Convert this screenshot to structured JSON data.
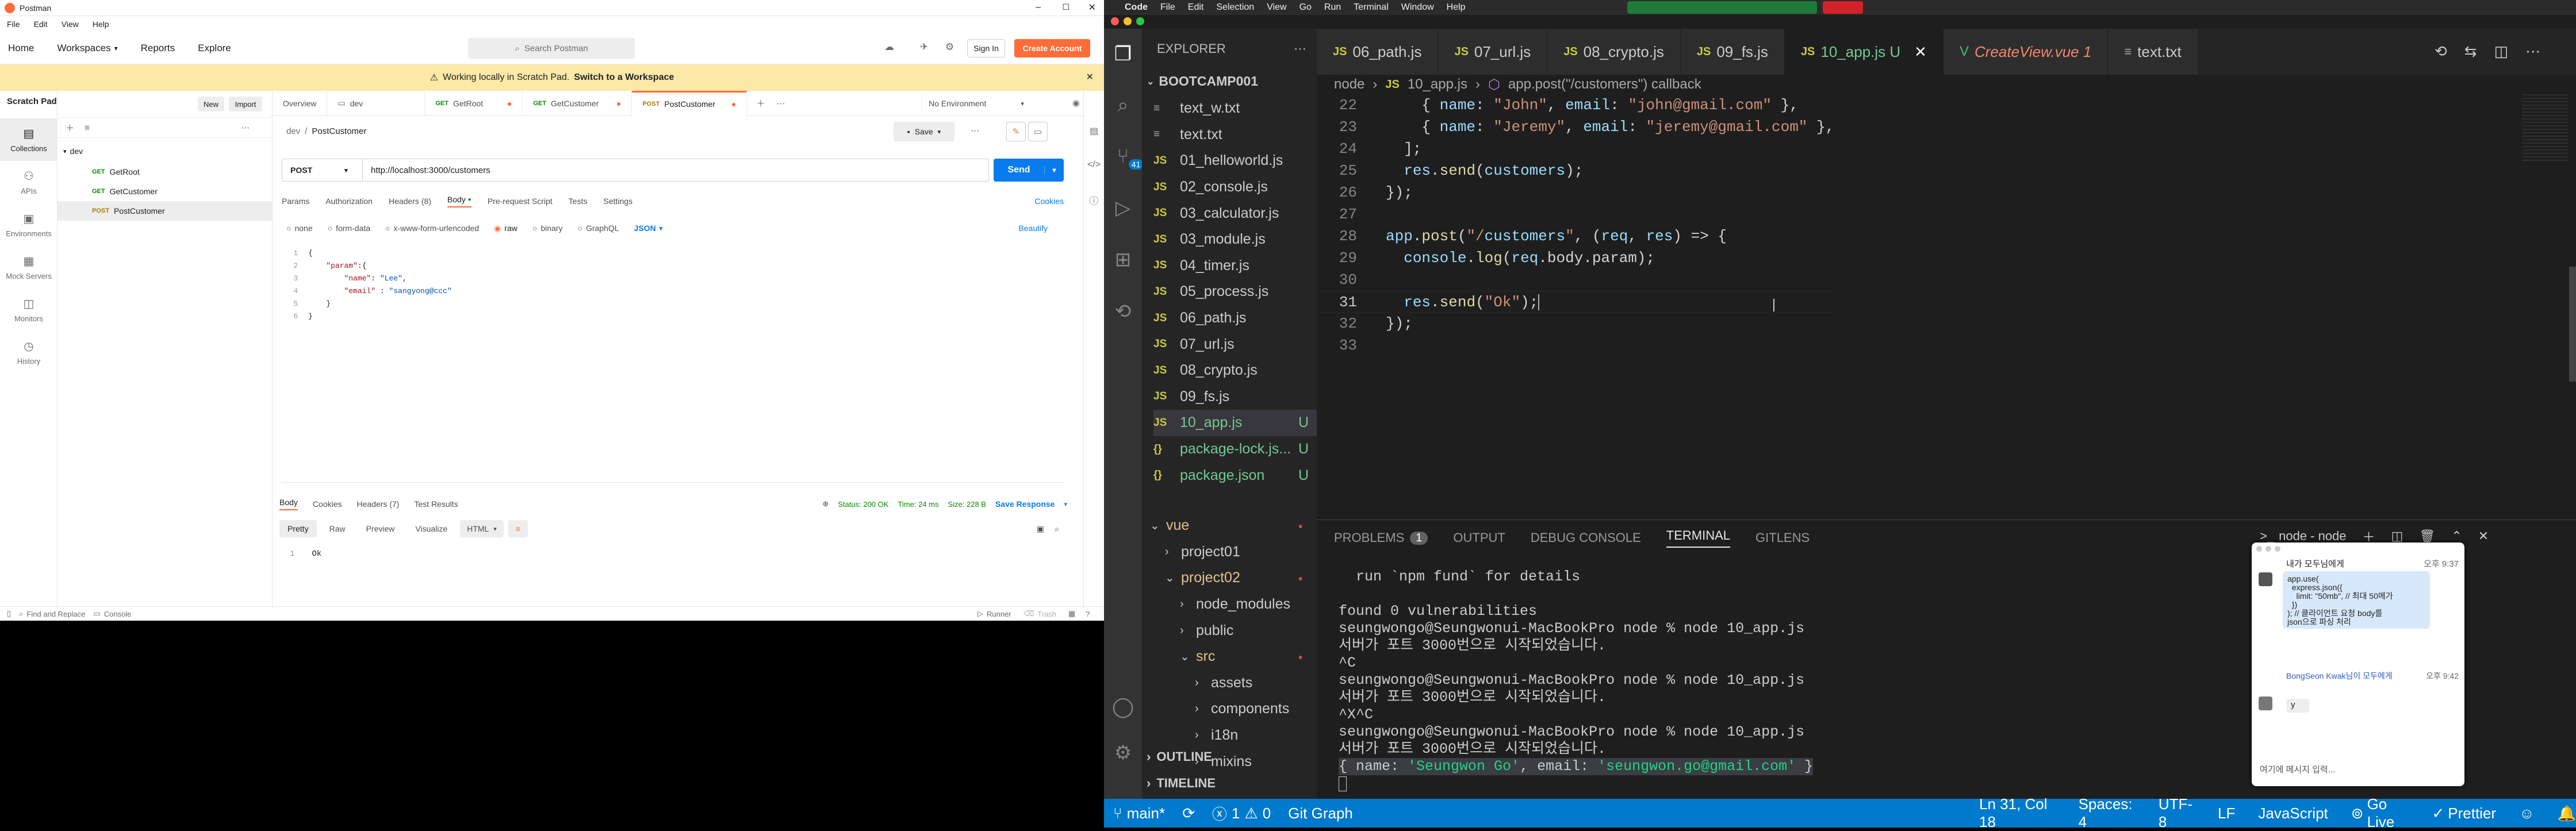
{
  "postman": {
    "window_title": "Postman",
    "menu": [
      "File",
      "Edit",
      "View",
      "Help"
    ],
    "top_nav": {
      "home": "Home",
      "workspaces": "Workspaces",
      "reports": "Reports",
      "explore": "Explore",
      "search_placeholder": "Search Postman",
      "sign_in": "Sign In",
      "create_account": "Create Account"
    },
    "banner": {
      "text": "Working locally in Scratch Pad.",
      "link": "Switch to a Workspace"
    },
    "sidebar": {
      "title": "Scratch Pad",
      "new": "New",
      "import": "Import",
      "items": [
        {
          "label": "Collections",
          "icon": "collections-icon"
        },
        {
          "label": "APIs",
          "icon": "apis-icon"
        },
        {
          "label": "Environments",
          "icon": "environments-icon"
        },
        {
          "label": "Mock Servers",
          "icon": "mock-servers-icon"
        },
        {
          "label": "Monitors",
          "icon": "monitors-icon"
        },
        {
          "label": "History",
          "icon": "history-icon"
        }
      ]
    },
    "tree": {
      "folder": "dev",
      "requests": [
        {
          "method": "GET",
          "name": "GetRoot"
        },
        {
          "method": "GET",
          "name": "GetCustomer"
        },
        {
          "method": "POST",
          "name": "PostCustomer"
        }
      ]
    },
    "tabs": [
      {
        "label": "Overview",
        "method": ""
      },
      {
        "label": "dev",
        "method": ""
      },
      {
        "label": "GetRoot",
        "method": "GET"
      },
      {
        "label": "GetCustomer",
        "method": "GET"
      },
      {
        "label": "PostCustomer",
        "method": "POST"
      }
    ],
    "environment": "No Environment",
    "breadcrumb": {
      "parent": "dev",
      "current": "PostCustomer"
    },
    "save": "Save",
    "request": {
      "method": "POST",
      "url": "http://localhost:3000/customers",
      "send": "Send"
    },
    "req_tabs": [
      "Params",
      "Authorization",
      "Headers (8)",
      "Body",
      "Pre-request Script",
      "Tests",
      "Settings"
    ],
    "cookies": "Cookies",
    "body_types": [
      "none",
      "form-data",
      "x-www-form-urlencoded",
      "raw",
      "binary",
      "GraphQL"
    ],
    "body_format": "JSON",
    "beautify": "Beautify",
    "body_lines": [
      "{",
      "    \"param\":{",
      "        \"name\": \"Lee\",",
      "        \"email\" : \"sangyong@ccc\"",
      "    }",
      "}"
    ],
    "resp_tabs": [
      "Body",
      "Cookies",
      "Headers (7)",
      "Test Results"
    ],
    "status": {
      "status": "Status: 200 OK",
      "time": "Time: 24 ms",
      "size": "Size: 228 B",
      "save_response": "Save Response"
    },
    "resp_views": [
      "Pretty",
      "Raw",
      "Preview",
      "Visualize"
    ],
    "resp_format": "HTML",
    "response_line": "Ok",
    "footer": {
      "find": "Find and Replace",
      "console": "Console",
      "runner": "Runner",
      "trash": "Trash"
    }
  },
  "vscode": {
    "mac_menu": [
      "Code",
      "File",
      "Edit",
      "Selection",
      "View",
      "Go",
      "Run",
      "Terminal",
      "Window",
      "Help"
    ],
    "explorer_title": "EXPLORER",
    "project": "BOOTCAMP001",
    "files": [
      {
        "name": "text_w.txt",
        "type": "txt",
        "badge": ""
      },
      {
        "name": "text.txt",
        "type": "txt",
        "badge": ""
      },
      {
        "name": "01_helloworld.js",
        "type": "js",
        "badge": ""
      },
      {
        "name": "02_console.js",
        "type": "js",
        "badge": ""
      },
      {
        "name": "03_calculator.js",
        "type": "js",
        "badge": ""
      },
      {
        "name": "03_module.js",
        "type": "js",
        "badge": ""
      },
      {
        "name": "04_timer.js",
        "type": "js",
        "badge": ""
      },
      {
        "name": "05_process.js",
        "type": "js",
        "badge": ""
      },
      {
        "name": "06_path.js",
        "type": "js",
        "badge": ""
      },
      {
        "name": "07_url.js",
        "type": "js",
        "badge": ""
      },
      {
        "name": "08_crypto.js",
        "type": "js",
        "badge": ""
      },
      {
        "name": "09_fs.js",
        "type": "js",
        "badge": ""
      },
      {
        "name": "10_app.js",
        "type": "js",
        "badge": "U"
      },
      {
        "name": "package-lock.js...",
        "type": "json",
        "badge": "U"
      },
      {
        "name": "package.json",
        "type": "json",
        "badge": "U"
      }
    ],
    "folders": [
      {
        "name": "vue",
        "indent": 0,
        "open": true
      },
      {
        "name": "project01",
        "indent": 1,
        "open": false
      },
      {
        "name": "project02",
        "indent": 1,
        "open": true
      },
      {
        "name": "node_modules",
        "indent": 2,
        "open": false
      },
      {
        "name": "public",
        "indent": 2,
        "open": false
      },
      {
        "name": "src",
        "indent": 2,
        "open": true
      },
      {
        "name": "assets",
        "indent": 3,
        "open": false
      },
      {
        "name": "components",
        "indent": 3,
        "open": false
      },
      {
        "name": "i18n",
        "indent": 3,
        "open": false
      },
      {
        "name": "mixins",
        "indent": 3,
        "open": false
      }
    ],
    "outline": "OUTLINE",
    "timeline": "TIMELINE",
    "tabs": [
      {
        "label": "06_path.js",
        "kind": "js"
      },
      {
        "label": "07_url.js",
        "kind": "js"
      },
      {
        "label": "08_crypto.js",
        "kind": "js"
      },
      {
        "label": "09_fs.js",
        "kind": "js"
      },
      {
        "label": "10_app.js U",
        "kind": "js"
      },
      {
        "label": "CreateView.vue 1",
        "kind": "vue"
      },
      {
        "label": "text.txt",
        "kind": "txt"
      }
    ],
    "breadcrumb": [
      "node",
      "10_app.js",
      "app.post(\"/customers\") callback"
    ],
    "code": [
      {
        "n": "22",
        "t": "    { name: \"John\", email: \"john@gmail.com\" },"
      },
      {
        "n": "23",
        "t": "    { name: \"Jeremy\", email: \"jeremy@gmail.com\" },"
      },
      {
        "n": "24",
        "t": "  ];"
      },
      {
        "n": "25",
        "t": "  res.send(customers);"
      },
      {
        "n": "26",
        "t": "});"
      },
      {
        "n": "27",
        "t": ""
      },
      {
        "n": "28",
        "t": "app.post(\"/customers\", (req, res) => {"
      },
      {
        "n": "29",
        "t": "  console.log(req.body.param);"
      },
      {
        "n": "30",
        "t": ""
      },
      {
        "n": "31",
        "t": "  res.send(\"Ok\");"
      },
      {
        "n": "32",
        "t": "});"
      },
      {
        "n": "33",
        "t": ""
      }
    ],
    "panel_tabs": [
      "PROBLEMS",
      "OUTPUT",
      "DEBUG CONSOLE",
      "TERMINAL",
      "GITLENS"
    ],
    "problems_count": "1",
    "terminal_name": "node - node",
    "terminal": [
      "  run `npm fund` for details",
      "",
      "found 0 vulnerabilities",
      "seungwongo@Seungwonui-MacBookPro node % node 10_app.js",
      "서버가 포트 3000번으로 시작되었습니다.",
      "^C",
      "seungwongo@Seungwonui-MacBookPro node % node 10_app.js",
      "서버가 포트 3000번으로 시작되었습니다.",
      "^X^C",
      "seungwongo@Seungwonui-MacBookPro node % node 10_app.js",
      "서버가 포트 3000번으로 시작되었습니다.",
      "{ name: 'Seungwon Go', email: 'seungwon.go@gmail.com' }"
    ],
    "status": {
      "branch": "main*",
      "errors": "1",
      "warnings": "0",
      "git_graph": "Git Graph",
      "position": "Ln 31, Col 18",
      "spaces": "Spaces: 4",
      "encoding": "UTF-8",
      "eol": "LF",
      "language": "JavaScript",
      "golive": "Go Live",
      "prettier": "Prettier"
    },
    "scm_badge": "41",
    "account_badge": "1"
  },
  "chat": {
    "header": "내가 모두님에게",
    "time1": "오후 9:37",
    "msg_lines": [
      "app.use(",
      "  express.json({",
      "    limit: \"50mb\", // 최대 50메가",
      "  })",
      "); // 클라이언트 요청 body를",
      "json으로 파싱 처리"
    ],
    "from2": "BongSeon Kwak님이 모두에게",
    "time2": "오후 9:42",
    "msg2": "y",
    "input_placeholder": "여기에 메시지 입력..."
  },
  "colors": {
    "postman_orange": "#ff6c37",
    "postman_send": "#097bed",
    "vscode_status": "#007acc",
    "vscode_bg": "#1e1e1e"
  }
}
